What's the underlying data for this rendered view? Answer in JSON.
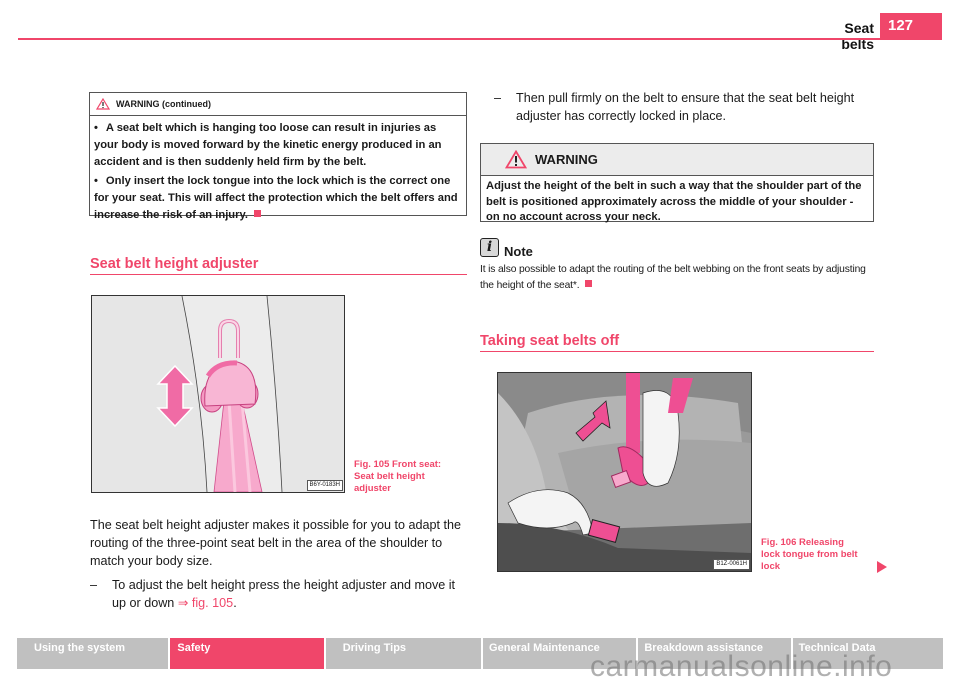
{
  "header": {
    "section_title": "Seat belts",
    "page_number": "127",
    "accent_color": "#f0466a"
  },
  "warning_continued": {
    "icon": "warning-triangle-icon",
    "title": "WARNING (continued)",
    "bullets": [
      "A seat belt which is hanging too loose can result in injuries as your body is moved forward by the kinetic energy produced in an accident and is then suddenly held firm by the belt.",
      "Only insert the lock tongue into the lock which is the correct one for your seat. This will affect the protection which the belt offers and increase the risk of an injury."
    ]
  },
  "section_height_adjuster": {
    "title": "Seat belt height adjuster",
    "figure": {
      "code": "B6Y-0183H",
      "caption_line1": "Fig. 105   Front seat:",
      "caption_line2": "Seat belt height",
      "caption_line3": "adjuster"
    },
    "paragraph": "The seat belt height adjuster makes it possible for you to adapt the routing of the three-point seat belt in the area of the shoulder to match your body size.",
    "step1_text": "To adjust the belt height press the height adjuster and move it up or down ",
    "step1_link": "⇒ fig. 105",
    "step1_end": ".",
    "dash": "–"
  },
  "right_column": {
    "step2": "Then pull firmly on the belt to ensure that the seat belt height adjuster has correctly locked in place.",
    "warning": {
      "icon": "warning-triangle-icon",
      "title": "WARNING",
      "text": "Adjust the height of the belt in such a way that the shoulder part of the belt is positioned approximately across the middle of your shoulder - on no account across your neck."
    },
    "note": {
      "icon": "info-icon",
      "icon_glyph": "i",
      "label": "Note",
      "text": "It is also possible to adapt the routing of the belt webbing on the front seats by adjusting the height of the seat*."
    }
  },
  "section_taking_off": {
    "title": "Taking seat belts off",
    "figure": {
      "code": "B1Z-0061H",
      "caption_line1": "Fig. 106   Releasing",
      "caption_line2": "lock tongue from belt",
      "caption_line3": "lock"
    }
  },
  "bullet_glyph": "•",
  "nav": {
    "tabs": [
      {
        "label": "Using the system",
        "active": false
      },
      {
        "label": "Safety",
        "active": true
      },
      {
        "label": "Driving Tips",
        "active": false
      },
      {
        "label": "General Maintenance",
        "active": false
      },
      {
        "label": "Breakdown assistance",
        "active": false
      },
      {
        "label": "Technical Data",
        "active": false
      }
    ]
  },
  "watermark": "carmanualsonline.info"
}
